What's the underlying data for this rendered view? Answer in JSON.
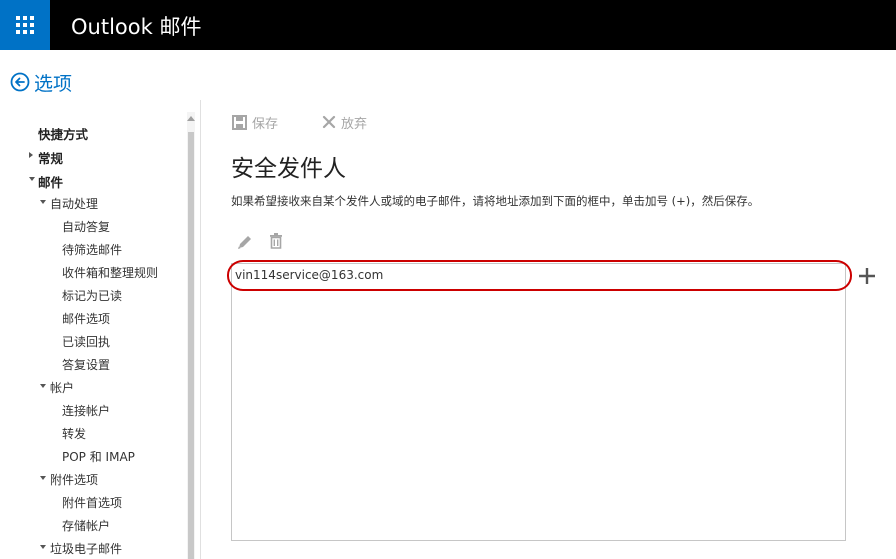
{
  "app": {
    "title": "Outlook 邮件"
  },
  "header": {
    "back_label": "选项"
  },
  "nav": {
    "items": [
      {
        "label": "快捷方式",
        "level": 0,
        "expander": "none"
      },
      {
        "label": "常规",
        "level": 0,
        "expander": "collapsed"
      },
      {
        "label": "邮件",
        "level": 0,
        "expander": "expanded"
      },
      {
        "label": "自动处理",
        "level": 1,
        "expander": "expanded"
      },
      {
        "label": "自动答复",
        "level": 2,
        "expander": "none"
      },
      {
        "label": "待筛选邮件",
        "level": 2,
        "expander": "none"
      },
      {
        "label": "收件箱和整理规则",
        "level": 2,
        "expander": "none"
      },
      {
        "label": "标记为已读",
        "level": 2,
        "expander": "none"
      },
      {
        "label": "邮件选项",
        "level": 2,
        "expander": "none"
      },
      {
        "label": "已读回执",
        "level": 2,
        "expander": "none"
      },
      {
        "label": "答复设置",
        "level": 2,
        "expander": "none"
      },
      {
        "label": "帐户",
        "level": 1,
        "expander": "expanded"
      },
      {
        "label": "连接帐户",
        "level": 2,
        "expander": "none"
      },
      {
        "label": "转发",
        "level": 2,
        "expander": "none"
      },
      {
        "label": "POP 和 IMAP",
        "level": 2,
        "expander": "none"
      },
      {
        "label": "附件选项",
        "level": 1,
        "expander": "expanded"
      },
      {
        "label": "附件首选项",
        "level": 2,
        "expander": "none"
      },
      {
        "label": "存储帐户",
        "level": 2,
        "expander": "none"
      },
      {
        "label": "垃圾电子邮件",
        "level": 1,
        "expander": "expanded"
      }
    ]
  },
  "toolbar": {
    "save_label": "保存",
    "discard_label": "放弃"
  },
  "main": {
    "title": "安全发件人",
    "description": "如果希望接收来自某个发件人或域的电子邮件，请将地址添加到下面的框中，单击加号 (+)，然后保存。",
    "entries": [
      "vin114service@163.com"
    ]
  },
  "colors": {
    "accent": "#0072c6",
    "topbar": "#000000",
    "highlight": "#cc0000"
  }
}
